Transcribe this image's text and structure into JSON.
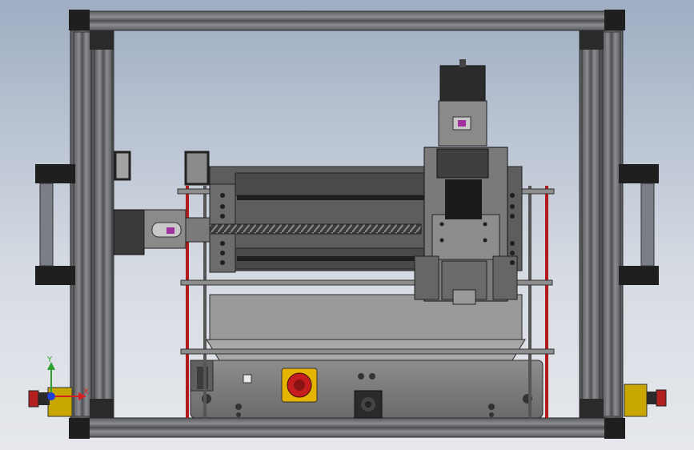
{
  "viewport": {
    "background_top": "#9fadc3",
    "background_bottom": "#e6e8ec"
  },
  "model": {
    "frame_color": "#6d6f72",
    "dark_color": "#2b2b2b",
    "body_color": "#7a7a7a",
    "rail_color": "#b11b1b",
    "estop_color": "#e4b400",
    "estop_button_color": "#c51d1d"
  },
  "triad": {
    "x_label": "X",
    "y_label": "Y",
    "x_color": "#d42020",
    "y_color": "#2fa02f",
    "z_color": "#1f3fd8"
  }
}
